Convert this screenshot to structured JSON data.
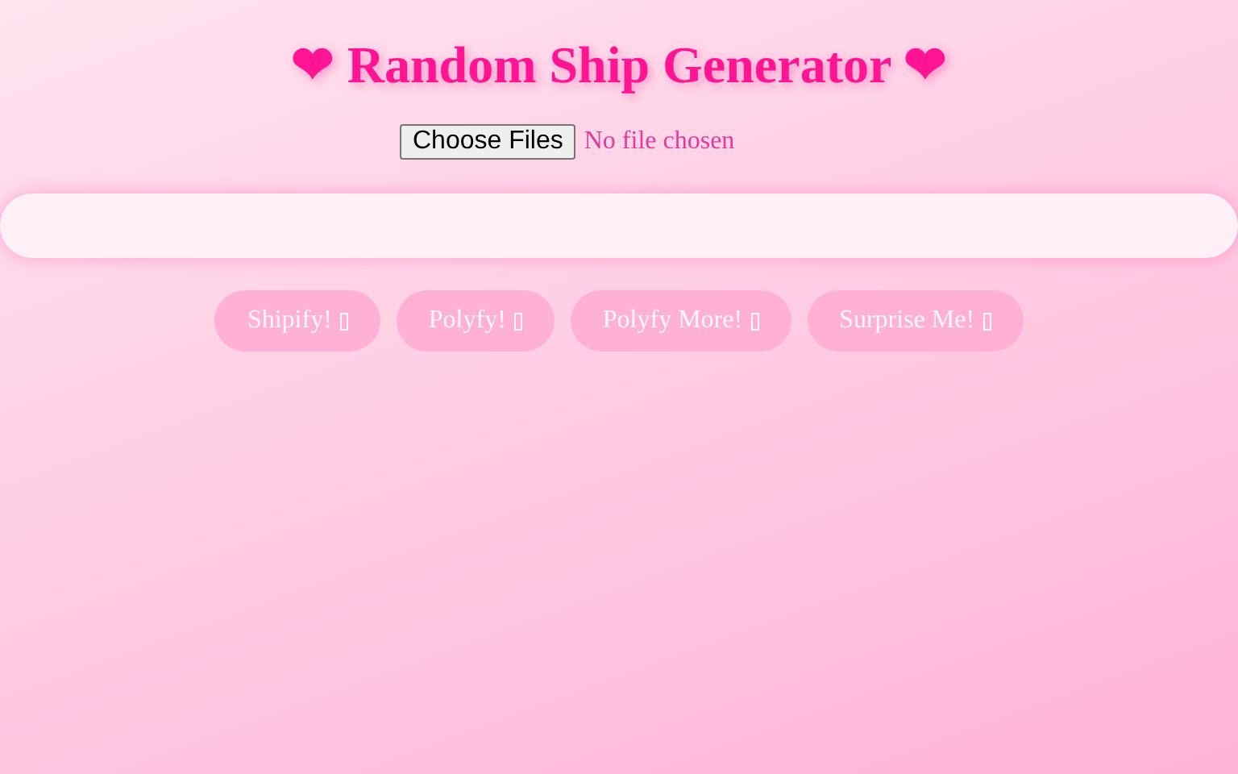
{
  "title": "❤ Random Ship Generator ❤",
  "file_picker": {
    "button": "Choose Files",
    "status": "No file chosen"
  },
  "buttons": [
    {
      "label": "Shipify!"
    },
    {
      "label": "Polyfy!"
    },
    {
      "label": "Polyfy More!"
    },
    {
      "label": "Surprise Me!"
    }
  ]
}
